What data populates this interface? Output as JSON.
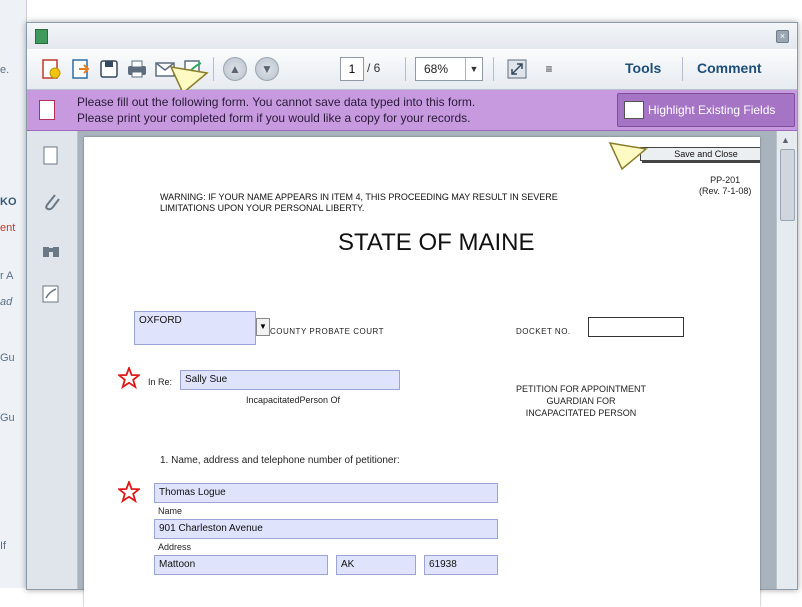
{
  "background_app": {
    "fragments": [
      "e.",
      "KO",
      "ent",
      "r A",
      "ad",
      "Gu",
      "Gu",
      "If"
    ]
  },
  "window": {
    "app_icon": "acrobat-icon",
    "close_icon": "close-icon"
  },
  "toolbar": {
    "icons": [
      "create-icon",
      "export-icon",
      "save-icon",
      "print-icon",
      "email-icon",
      "sign-icon",
      "prev-page-icon",
      "next-page-icon",
      "fit-page-icon",
      "options-icon"
    ],
    "page_number": "1",
    "page_total": "/ 6",
    "zoom_value": "68%",
    "zoom_dropdown": "▼",
    "tools_label": "Tools",
    "comment_label": "Comment"
  },
  "notice": {
    "line1": "Please fill out the following form. You cannot save data typed into this form.",
    "line2": "Please print your completed form if you would like a copy for your records.",
    "highlight_button": "Highlight Existing Fields"
  },
  "left_nav": {
    "icons": [
      "pages-icon",
      "attachments-icon",
      "binoculars-icon",
      "signatures-icon"
    ]
  },
  "form": {
    "save_close": "Save and Close",
    "form_no_line1": "PP-201",
    "form_no_line2": "(Rev. 7-1-08)",
    "warning_line1": "WARNING: IF YOUR NAME APPEARS IN ITEM 4, THIS PROCEEDING MAY RESULT IN SEVERE",
    "warning_line2": "LIMITATIONS UPON YOUR PERSONAL LIBERTY.",
    "state_title": "STATE OF MAINE",
    "county_value": "OXFORD",
    "county_dropdown": "▼",
    "county_label": "COUNTY  PROBATE COURT",
    "docket_label": "DOCKET NO.",
    "docket_value": "",
    "in_re_label": "In Re:",
    "in_re_value": "Sally Sue",
    "incap_label": "IncapacitatedPerson    Of",
    "petition_line1": "PETITION FOR APPOINTMENT",
    "petition_line2": "GUARDIAN   FOR",
    "petition_line3": "INCAPACITATED PERSON",
    "item1_label": "1.  Name, address and telephone number of petitioner:",
    "name_value": "Thomas  Logue",
    "name_label": "Name",
    "address_value": "901 Charleston Avenue",
    "address_label": "Address",
    "city_value": "Mattoon",
    "state_value": "AK",
    "zip_value": "61938"
  }
}
